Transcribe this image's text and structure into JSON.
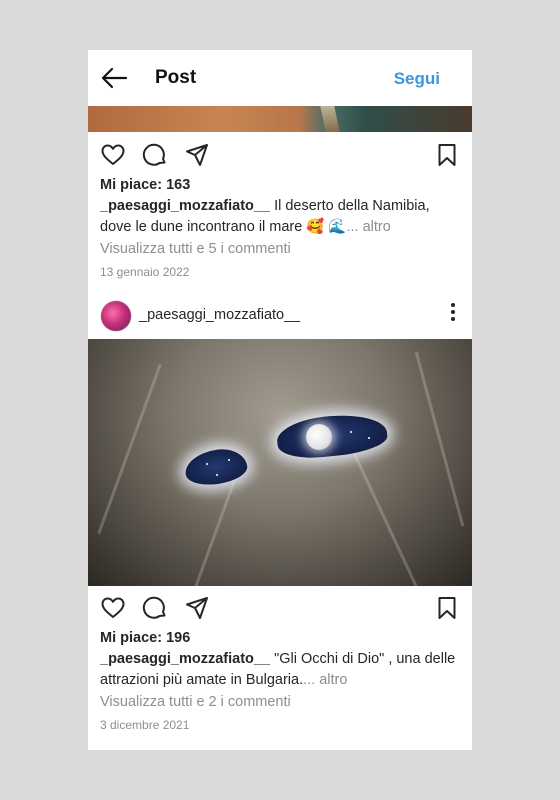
{
  "header": {
    "title": "Post",
    "follow_label": "Segui"
  },
  "posts": [
    {
      "likes": "Mi piace: 163",
      "username": "_paesaggi_mozzafiato__",
      "caption": " Il deserto della Namibia, dove le dune incontrano il mare 🥰 🌊",
      "more": "... altro",
      "comments": "Visualizza tutti e 5 i commenti",
      "date": "13 gennaio 2022"
    },
    {
      "author": "_paesaggi_mozzafiato__",
      "likes": "Mi piace: 196",
      "username": "_paesaggi_mozzafiato__",
      "caption": " \"Gli Occhi di Dio\" , una delle attrazioni più amate in Bulgaria.",
      "more": "... altro",
      "comments": "Visualizza tutti e 2 i commenti",
      "date": "3 dicembre 2021"
    }
  ],
  "icons": [
    "back-arrow-icon",
    "heart-icon",
    "comment-icon",
    "share-icon",
    "bookmark-icon",
    "more-options-icon"
  ],
  "colors": {
    "accent": "#3b96de",
    "text": "#262626",
    "muted": "#8e8e8e",
    "background": "#d9d9d9"
  }
}
